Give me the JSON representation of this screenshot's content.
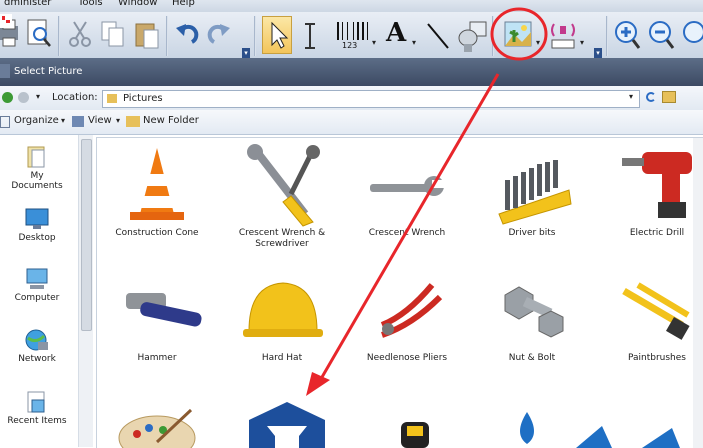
{
  "menu": [
    "dminister",
    "Tools",
    "Window",
    "Help"
  ],
  "dialog": {
    "title": "Select Picture",
    "location_label": "Location:",
    "location_value": "Pictures",
    "organize_label": "Organize",
    "view_label": "View",
    "new_folder_label": "New Folder"
  },
  "sidebar": [
    {
      "label": "My Documents",
      "icon": "my-documents-icon"
    },
    {
      "label": "Desktop",
      "icon": "desktop-icon"
    },
    {
      "label": "Computer",
      "icon": "computer-icon"
    },
    {
      "label": "Network",
      "icon": "network-icon"
    },
    {
      "label": "Recent Items",
      "icon": "recent-items-icon"
    }
  ],
  "pictures": [
    {
      "label": "Construction Cone",
      "icon": "construction-cone-icon"
    },
    {
      "label": "Crescent Wrench & Screwdriver",
      "icon": "wrench-screwdriver-icon"
    },
    {
      "label": "Crescent Wrench",
      "icon": "crescent-wrench-icon"
    },
    {
      "label": "Driver bits",
      "icon": "driver-bits-icon"
    },
    {
      "label": "Electric Drill",
      "icon": "electric-drill-icon"
    },
    {
      "label": "Hammer",
      "icon": "hammer-icon"
    },
    {
      "label": "Hard Hat",
      "icon": "hard-hat-icon"
    },
    {
      "label": "Needlenose Pliers",
      "icon": "pliers-icon"
    },
    {
      "label": "Nut & Bolt",
      "icon": "nut-bolt-icon"
    },
    {
      "label": "Paintbrushes",
      "icon": "paintbrushes-icon"
    }
  ],
  "toolbar": {
    "barcode_caption": "123",
    "text_tool_glyph": "A"
  },
  "colors": {
    "annotation_red": "#e8262b",
    "titlebar": "#4a5a74",
    "toolbar_blue": "#2b4f8a"
  }
}
